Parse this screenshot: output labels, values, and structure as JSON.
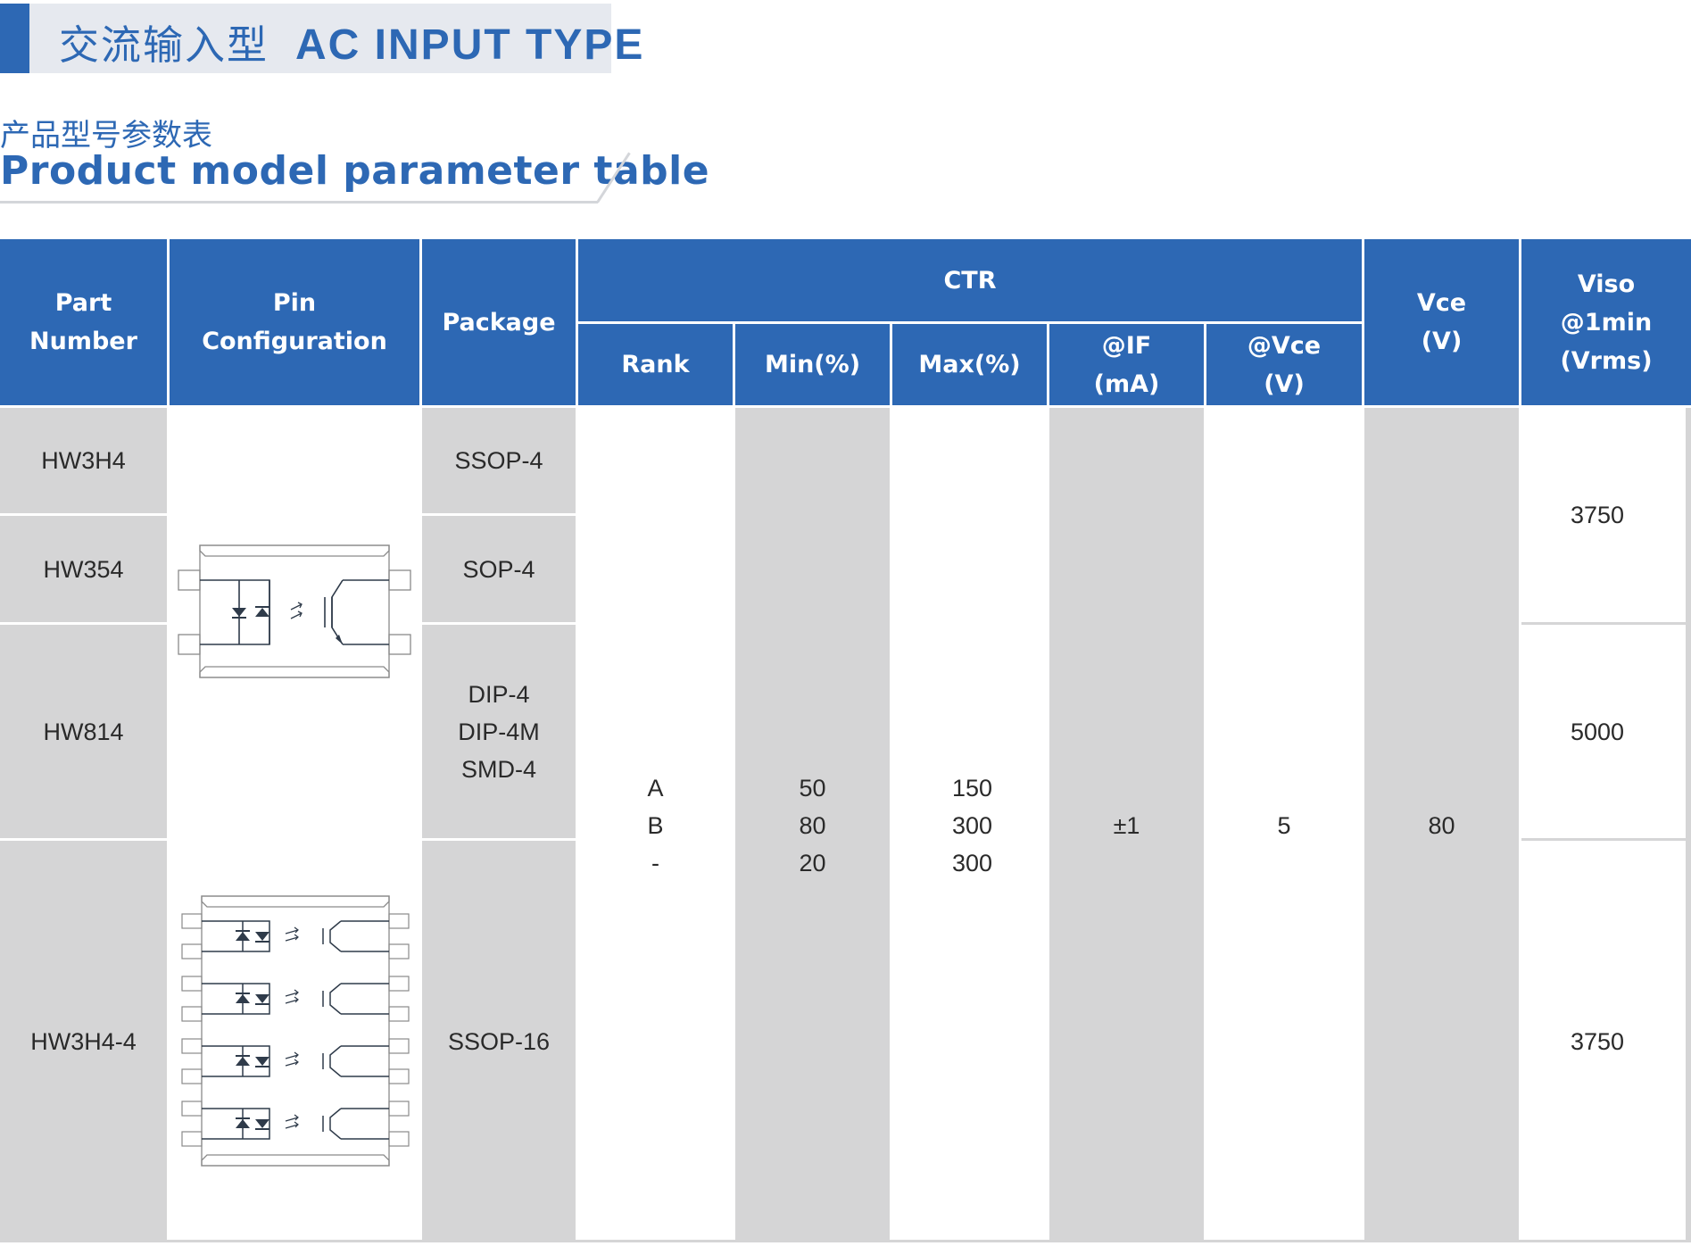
{
  "banner": {
    "title_cn": "交流输入型",
    "title_en": "AC INPUT TYPE",
    "accent_color": "#2d68b4"
  },
  "subtitle": {
    "cn": "产品型号参数表",
    "en": "Product model parameter table"
  },
  "table": {
    "headers": {
      "part_number": [
        "Part",
        "Number"
      ],
      "pin_configuration": [
        "Pin",
        "Configuration"
      ],
      "package": "Package",
      "ctr": "CTR",
      "rank": "Rank",
      "min": "Min(%)",
      "max": "Max(%)",
      "if": [
        "@IF",
        "(mA)"
      ],
      "vce_cond": [
        "@Vce",
        "(V)"
      ],
      "vce": [
        "Vce",
        "(V)"
      ],
      "viso": [
        "Viso",
        "@1min",
        "(Vrms)"
      ]
    },
    "parts": [
      "HW3H4",
      "HW354",
      "HW814",
      "HW3H4-4"
    ],
    "packages": {
      "hw3h4": "SSOP-4",
      "hw354": "SOP-4",
      "hw814": [
        "DIP-4",
        "DIP-4M",
        "SMD-4"
      ],
      "hw3h4_4": "SSOP-16"
    },
    "ranks": [
      "A",
      "B",
      "-"
    ],
    "ctr_min": [
      "50",
      "80",
      "20"
    ],
    "ctr_max": [
      "150",
      "300",
      "300"
    ],
    "if_value": "±1",
    "vce_cond_value": "5",
    "vce_value": "80",
    "viso": [
      "3750",
      "5000",
      "3750"
    ],
    "colors": {
      "header": "#2d68b4",
      "shade": "#d5d5d6"
    },
    "pin_diagrams": [
      "single-channel-ac-optocoupler-diagram",
      "quad-channel-ac-optocoupler-diagram"
    ]
  }
}
